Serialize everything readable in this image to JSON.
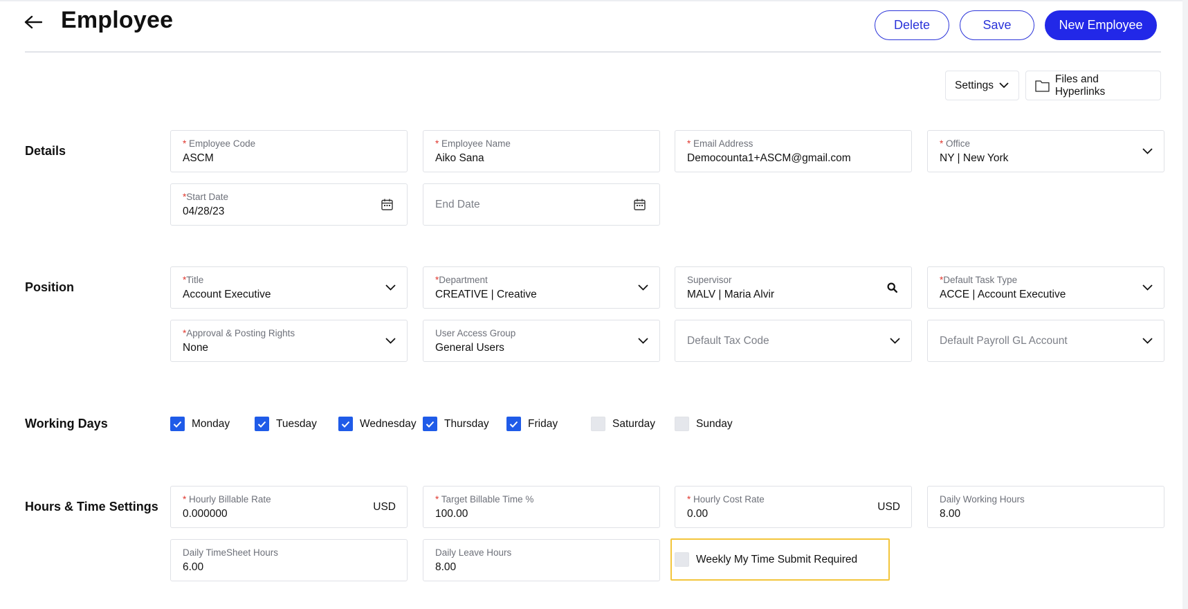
{
  "header": {
    "title": "Employee",
    "delete_label": "Delete",
    "save_label": "Save",
    "new_label": "New Employee",
    "accent": "#2228e8"
  },
  "toolbar": {
    "settings_label": "Settings",
    "files_label": "Files and Hyperlinks"
  },
  "sections": {
    "details": "Details",
    "position": "Position",
    "working_days": "Working Days",
    "hours": "Hours & Time Settings"
  },
  "required_mark": "*",
  "details": {
    "employee_code": {
      "label": "Employee Code",
      "value": "ASCM"
    },
    "employee_name": {
      "label": "Employee Name",
      "value": "Aiko Sana"
    },
    "email": {
      "label": "Email Address",
      "value": "Democounta1+ASCM@gmail.com"
    },
    "office": {
      "label": "Office",
      "value": "NY | New York"
    },
    "start_date": {
      "label": "Start Date",
      "value": "04/28/23"
    },
    "end_date": {
      "placeholder": "End Date"
    }
  },
  "position": {
    "title": {
      "label": "Title",
      "value": "Account Executive"
    },
    "department": {
      "label": "Department",
      "value": "CREATIVE | Creative"
    },
    "supervisor": {
      "label": "Supervisor",
      "value": "MALV | Maria Alvir"
    },
    "default_task_type": {
      "label": "Default Task Type",
      "value": "ACCE | Account Executive"
    },
    "approval_rights": {
      "label": "Approval & Posting Rights",
      "value": "None"
    },
    "user_access_group": {
      "label": "User Access Group",
      "value": "General Users"
    },
    "default_tax_code": {
      "placeholder": "Default Tax Code"
    },
    "default_payroll_gl": {
      "placeholder": "Default Payroll GL Account"
    }
  },
  "working_days": [
    {
      "label": "Monday",
      "checked": true
    },
    {
      "label": "Tuesday",
      "checked": true
    },
    {
      "label": "Wednesday",
      "checked": true
    },
    {
      "label": "Thursday",
      "checked": true
    },
    {
      "label": "Friday",
      "checked": true
    },
    {
      "label": "Saturday",
      "checked": false
    },
    {
      "label": "Sunday",
      "checked": false
    }
  ],
  "hours": {
    "hourly_billable_rate": {
      "label": "Hourly Billable Rate",
      "value": "0.000000",
      "unit": "USD"
    },
    "target_billable_time": {
      "label": "Target Billable Time %",
      "value": "100.00"
    },
    "hourly_cost_rate": {
      "label": "Hourly Cost Rate",
      "value": "0.00",
      "unit": "USD"
    },
    "daily_working_hours": {
      "label": "Daily Working Hours",
      "value": "8.00"
    },
    "daily_timesheet_hours": {
      "label": "Daily TimeSheet Hours",
      "value": "6.00"
    },
    "daily_leave_hours": {
      "label": "Daily Leave Hours",
      "value": "8.00"
    },
    "weekly_submit": {
      "label": "Weekly My Time Submit Required",
      "checked": false
    }
  }
}
